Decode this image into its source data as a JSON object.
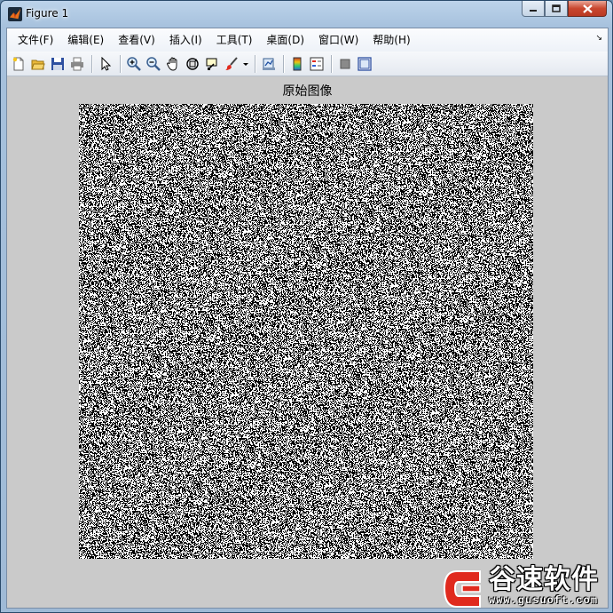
{
  "window": {
    "title": "Figure 1"
  },
  "menu": {
    "items": [
      "文件(F)",
      "编辑(E)",
      "查看(V)",
      "插入(I)",
      "工具(T)",
      "桌面(D)",
      "窗口(W)",
      "帮助(H)"
    ]
  },
  "toolbar": {
    "icons": [
      "new-figure-icon",
      "open-file-icon",
      "save-icon",
      "print-icon",
      "pointer-icon",
      "zoom-in-icon",
      "zoom-out-icon",
      "pan-icon",
      "rotate-3d-icon",
      "data-cursor-icon",
      "brush-icon",
      "link-plot-icon",
      "colorbar-icon",
      "legend-icon",
      "hide-plot-tools-icon",
      "show-plot-tools-icon"
    ]
  },
  "axes": {
    "title": "原始图像"
  },
  "image": {
    "type": "binary-noise",
    "colors": [
      "#000000",
      "#ffffff"
    ],
    "white_fraction": 0.5
  },
  "watermark": {
    "name": "谷速软件",
    "url": "www.gusuoft.com"
  },
  "colors": {
    "accent_red": "#e02a1e",
    "client_bg": "#cacaca",
    "title_glass": "#a6c1dd"
  }
}
